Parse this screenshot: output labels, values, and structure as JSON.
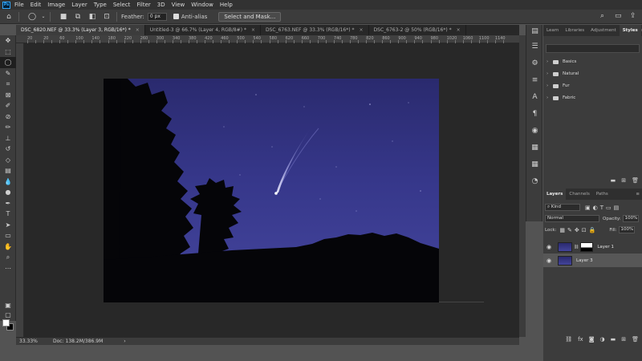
{
  "app": {
    "logo_text": "Ps",
    "accent": "#31a8ff"
  },
  "menu": [
    "File",
    "Edit",
    "Image",
    "Layer",
    "Type",
    "Select",
    "Filter",
    "3D",
    "View",
    "Window",
    "Help"
  ],
  "options": {
    "feather_label": "Feather:",
    "feather_value": "0 px",
    "antialias_label": "Anti-alias",
    "antialias_checked": true,
    "select_mask_label": "Select and Mask..."
  },
  "tabs": [
    {
      "label": "DSC_6820.NEF @ 33.3% (Layer 3, RGB/16*) *",
      "active": true
    },
    {
      "label": "Untitled-3 @ 66.7% (Layer 4, RGB/8#) *",
      "active": false
    },
    {
      "label": "DSC_6763.NEF @ 33.3% (RGB/16*) *",
      "active": false
    },
    {
      "label": "DSC_6763-2 @ 50% (RGB/16*) *",
      "active": false
    }
  ],
  "ruler_ticks": [
    "20",
    "0",
    "20",
    "40",
    "60",
    "80",
    "100",
    "120",
    "140",
    "160",
    "180",
    "200",
    "220",
    "240",
    "260",
    "280",
    "300",
    "320",
    "340",
    "360",
    "380",
    "400",
    "420",
    "440",
    "460",
    "480",
    "500",
    "520",
    "540",
    "560",
    "580",
    "600",
    "620",
    "640",
    "660",
    "680",
    "700",
    "720",
    "740",
    "760",
    "780",
    "800",
    "820",
    "840",
    "860",
    "880",
    "900",
    "920",
    "940",
    "960",
    "980",
    "1000",
    "1020",
    "1040",
    "1060",
    "1080",
    "1100",
    "1120",
    "1140",
    "1160",
    "1180",
    "1200"
  ],
  "status": {
    "zoom": "33.33%",
    "doc": "Doc: 138.2M/386.9M",
    "chevron": "›"
  },
  "styles_panel": {
    "tabs": [
      "Learn",
      "Libraries",
      "Adjustment",
      "Styles"
    ],
    "active_tab": "Styles",
    "folders": [
      "Basics",
      "Natural",
      "Fur",
      "Fabric"
    ]
  },
  "layers_panel": {
    "tabs": [
      "Layers",
      "Channels",
      "Paths"
    ],
    "active_tab": "Layers",
    "kind_label": "Kind",
    "blend_mode": "Normal",
    "opacity_label": "Opacity:",
    "opacity_value": "100%",
    "lock_label": "Lock:",
    "fill_label": "Fill:",
    "fill_value": "100%",
    "layers": [
      {
        "name": "Layer 1",
        "has_mask": true,
        "selected": false
      },
      {
        "name": "Layer 3",
        "has_mask": false,
        "selected": true
      }
    ]
  },
  "colors": {
    "sky_top": "#2a2a6e",
    "sky_bottom": "#43449a",
    "foreground": "#ffffff",
    "background": "#000000"
  }
}
